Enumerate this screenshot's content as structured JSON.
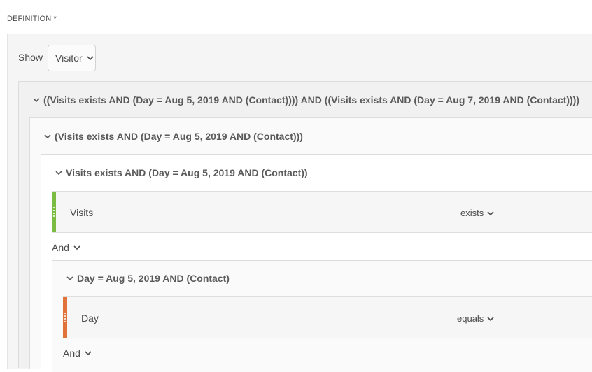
{
  "definition_label": "DEFINITION *",
  "show": {
    "label": "Show",
    "selected": "Visitor"
  },
  "containers": [
    {
      "header": "((Visits exists AND (Day = Aug 5, 2019 AND (Contact)))) AND ((Visits exists AND (Day = Aug 7, 2019 AND (Contact))))"
    },
    {
      "header": "(Visits exists AND (Day = Aug 5, 2019 AND (Contact)))"
    },
    {
      "header": "Visits exists AND (Day = Aug 5, 2019 AND (Contact))"
    },
    {
      "header": "Day = Aug 5, 2019 AND (Contact)"
    }
  ],
  "rules": [
    {
      "label": "Visits",
      "operator": "exists",
      "color": "#7cbc42"
    },
    {
      "label": "Day",
      "operator": "equals",
      "color": "#e0733a"
    }
  ],
  "conjunctions": [
    "And",
    "And"
  ]
}
